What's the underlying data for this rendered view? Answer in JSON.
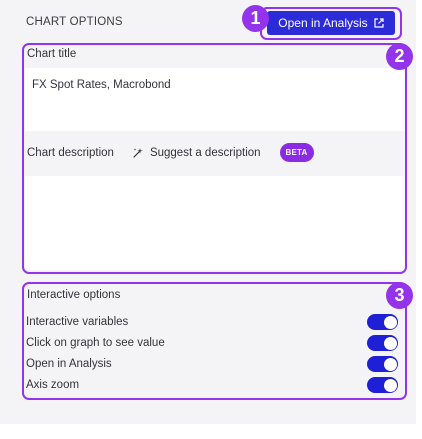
{
  "header": {
    "section_title": "CHART OPTIONS",
    "open_button_label": "Open in Analysis",
    "open_button_icon": "external-link-icon"
  },
  "annotations": [
    "1",
    "2",
    "3"
  ],
  "chart_title": {
    "label": "Chart title",
    "value": "FX Spot Rates, Macrobond"
  },
  "chart_description": {
    "label": "Chart description",
    "suggest_label": "Suggest a description",
    "suggest_icon": "sparkle-icon",
    "badge": "BETA",
    "value": ""
  },
  "interactive_options": {
    "title": "Interactive options",
    "items": [
      {
        "label": "Interactive variables",
        "enabled": true
      },
      {
        "label": "Click on graph to see value",
        "enabled": true
      },
      {
        "label": "Open in Analysis",
        "enabled": true
      },
      {
        "label": "Axis zoom",
        "enabled": true
      }
    ]
  },
  "colors": {
    "primary": "#2b2bd8",
    "annotation": "#9333ea",
    "beta": "#8b2be2",
    "toggle_on": "#1f1fd6",
    "panel_bg": "#f4f4f6"
  }
}
